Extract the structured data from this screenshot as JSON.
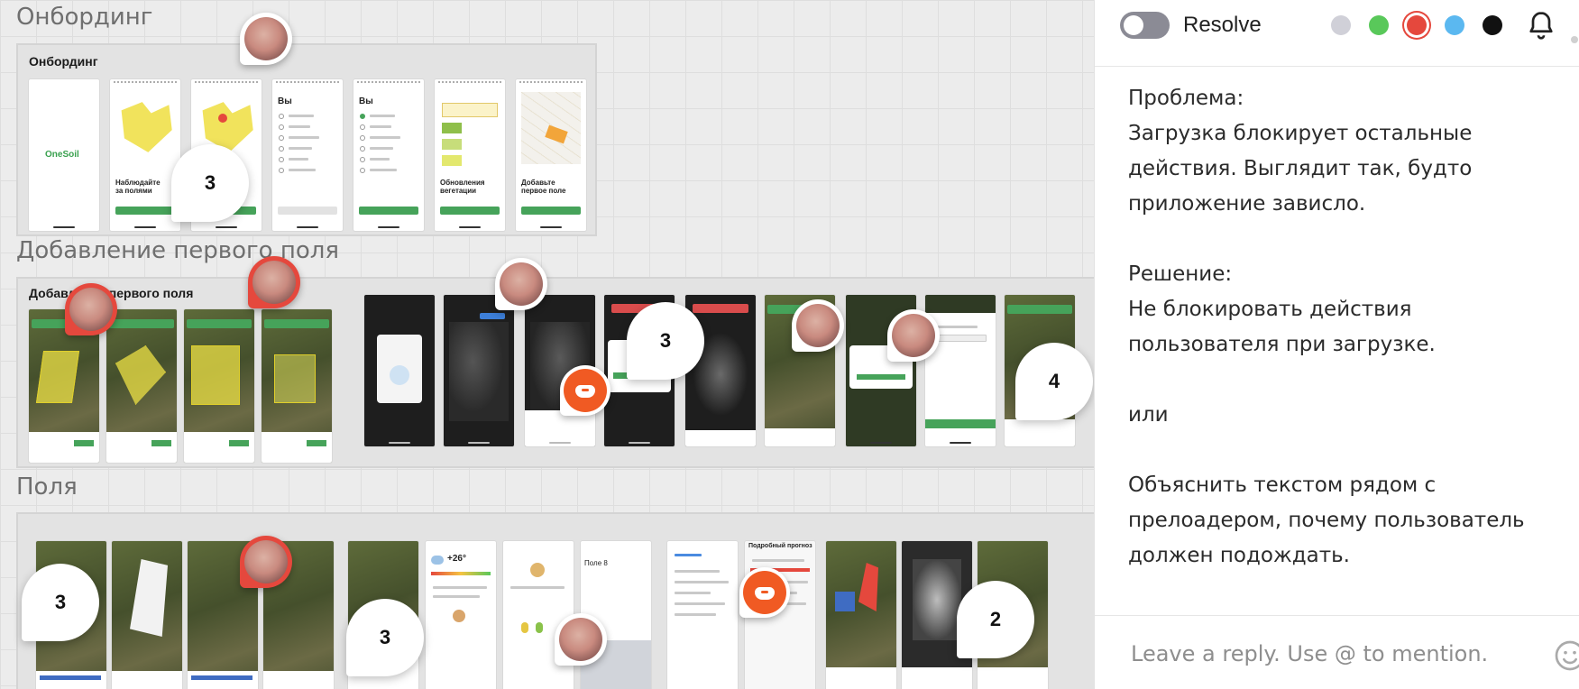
{
  "canvas": {
    "sections": [
      {
        "title": "Онбординг",
        "frame_label": "Онбординг"
      },
      {
        "title": "Добавление первого поля",
        "frame_label": "Добавление первого поля"
      },
      {
        "title": "Поля"
      }
    ],
    "onboarding_screens": {
      "logo": "OneSoil",
      "heading_watch": "Наблюдайте за полями",
      "heading_you_1": "Вы",
      "heading_you_2": "Вы",
      "heading_vegetation": "Обновления вегетации",
      "heading_add_field": "Добавьте первое поле"
    },
    "fields_screens": {
      "weather_temp": "+26°",
      "field_name": "Поле 8",
      "forecast_title": "Подробный прогноз"
    },
    "markers": [
      "3",
      "3",
      "4",
      "3",
      "3",
      "2"
    ]
  },
  "panel": {
    "resolve_label": "Resolve",
    "colors": [
      "#d0d0d8",
      "#59c85a",
      "#e5483d",
      "#5bb8f0",
      "#111111"
    ],
    "selected_color": "#e5483d",
    "comment_text": "Проблема:\nЗагрузка блокирует остальные действия. Выглядит так, будто приложение зависло.\n\nРешение:\nНе блокировать действия пользователя при загрузке.\n\nили\n\nОбъяснить текстом рядом с прелоадером, почему пользователь должен подождать.",
    "reply_placeholder": "Leave a reply. Use @ to mention.",
    "icons": {
      "bell": "bell-icon",
      "emoji": "emoji-icon",
      "toggle": "resolve-toggle"
    }
  }
}
